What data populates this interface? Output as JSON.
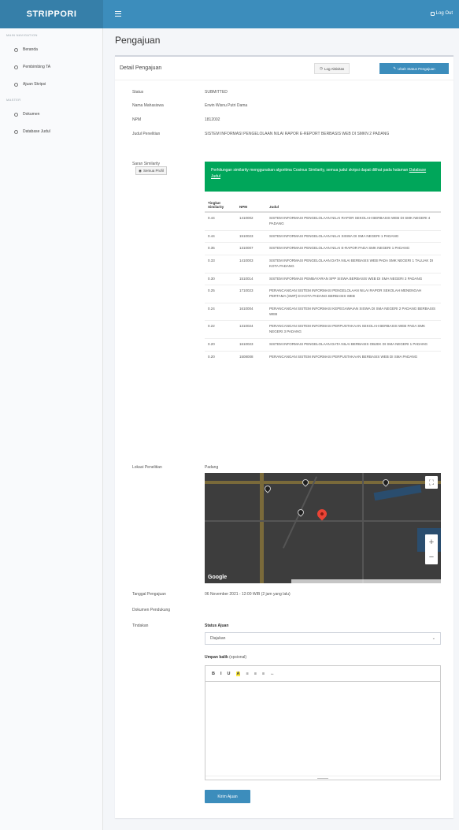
{
  "topbar": {
    "brand": "STRIPPORI",
    "logout": "Log Out"
  },
  "sidebar": {
    "header_main": "MAIN NAVIGATION",
    "items_main": [
      {
        "label": "Beranda"
      },
      {
        "label": "Pembimbing TA"
      },
      {
        "label": "Ajuan Skripsi"
      }
    ],
    "header_second": "MASTER",
    "items_second": [
      {
        "label": "Dokumen"
      },
      {
        "label": "Database Judul"
      }
    ]
  },
  "page": {
    "title": "Pengajuan"
  },
  "box": {
    "title": "Detail Pengajuan",
    "btn_history": "Log Aktivitas",
    "btn_status": "Ubah Status Pengajuan"
  },
  "details": {
    "status_label": "Status",
    "status_value": "SUBMITTED",
    "name_label": "Nama Mahasiswa",
    "name_value": "Erwin Wisnu Putri Dama",
    "npm_label": "NPM",
    "npm_value": "1812002",
    "title_label": "Judul Penelitian",
    "title_value": "SISTEM INFORMASI PENGELOLAAN NILAI RAPOR E-REPORT BERBASIS WEB DI SMKN 2 PADANG",
    "similarity_label": "Saran Similarity",
    "btn_all": "Semua Profil"
  },
  "alert": {
    "text": "Perhitungan similarity menggunakan algoritma Cosinus Similarity, semua judul skripsi dapat dilihat pada halaman",
    "link": "Database Judul"
  },
  "similarity_table": {
    "headers": [
      "Tingkat Similarity",
      "NPM",
      "Judul"
    ],
    "rows": [
      {
        "score": "0.44",
        "npm": "1410002",
        "title": "SISTEM INFORMASI PENGELOLAAN NILAI RAPOR SEKOLAH BERBASIS WEB DI SMK NEGERI 4 PADANG"
      },
      {
        "score": "0.44",
        "npm": "1510023",
        "title": "SISTEM INFORMASI PENGELOLAAN NILAI SISWA DI SMA NEGERI 1 PADANG"
      },
      {
        "score": "0.35",
        "npm": "1310007",
        "title": "SISTEM INFORMASI PENGELOLAAN NILAI E-RAPOR PADA SMK NEGERI 1 PADANG"
      },
      {
        "score": "0.33",
        "npm": "1410003",
        "title": "SISTEM INFORMASI PENGELOLAAN DATA NILAI BERBASIS WEB PADA SMK NEGERI 1 TALUAK DI KOTA PADANG"
      },
      {
        "score": "0.30",
        "npm": "1510014",
        "title": "SISTEM INFORMASI PEMBAYARAN SPP SISWA BERBASIS WEB DI SMA NEGERI 3 PADANG"
      },
      {
        "score": "0.25",
        "npm": "1710023",
        "title": "PERANCANGAN SISTEM INFORMASI PENGELOLAAN NILAI RAPOR SEKOLAH MENENGAH PERTAMA (SMP) DI KOTA PADANG BERBASIS WEB"
      },
      {
        "score": "0.24",
        "npm": "1610004",
        "title": "PERANCANGAN SISTEM INFORMASI KEPEGAWAIAN SISWA DI SMA NEGERI 2 PADANG BERBASIS WEB"
      },
      {
        "score": "0.22",
        "npm": "1310024",
        "title": "PERANCANGAN SISTEM INFORMASI PERPUSTAKAAN SEKOLAH BERBASIS WEB PADA SMK NEGERI 3 PADANG"
      },
      {
        "score": "0.20",
        "npm": "1610023",
        "title": "SISTEM INFORMASI PENGELOLAAN DATA NILAI BERBASIS OBJEK DI SMA NEGERI 1 PADANG"
      },
      {
        "score": "0.20",
        "npm": "1508008",
        "title": "PERANCANGAN SISTEM INFORMASI PERPUSTAKAAN BERBASIS WEB DI SMA PADANG"
      }
    ]
  },
  "location": {
    "label": "Lokasi Penelitian",
    "value": "Padang",
    "map_logo": "Google"
  },
  "misc": {
    "date_label": "Tanggal Pengajuan",
    "date_value": "06 November 2021 - 12:00 WIB (2 jam yang lalu)",
    "docs_label": "Dokumen Pendukung",
    "action_label": "Tindakan",
    "status_select_label": "Status Ajuan",
    "status_select_value": "Diajukan",
    "feedback_label": "Umpan balik",
    "feedback_optional": "(opsional)",
    "submit_button": "Kirim Ajuan"
  },
  "editor": {
    "toolbar": [
      "B",
      "I",
      "U",
      "A",
      "≡",
      "≡",
      "≡",
      "↔"
    ]
  }
}
